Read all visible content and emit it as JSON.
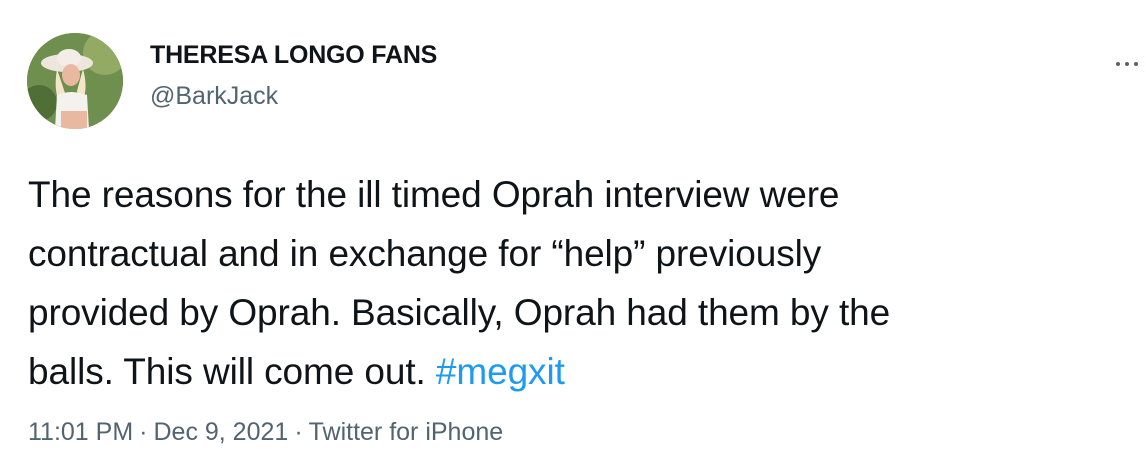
{
  "author": {
    "display_name": "THERESA LONGO FANS",
    "handle": "@BarkJack"
  },
  "tweet": {
    "lines": [
      "The reasons for the ill timed Oprah interview were",
      "contractual and in exchange for “help” previously",
      "provided by Oprah. Basically, Oprah had them by the",
      "balls. This will come out."
    ],
    "hashtag": "#megxit"
  },
  "meta": {
    "time": "11:01 PM",
    "separator": "·",
    "date": "Dec 9, 2021",
    "source": "Twitter for iPhone"
  },
  "icons": {
    "more": "more-horizontal-icon"
  },
  "colors": {
    "text": "#0f1419",
    "secondary": "#536471",
    "link": "#1d9bf0"
  }
}
